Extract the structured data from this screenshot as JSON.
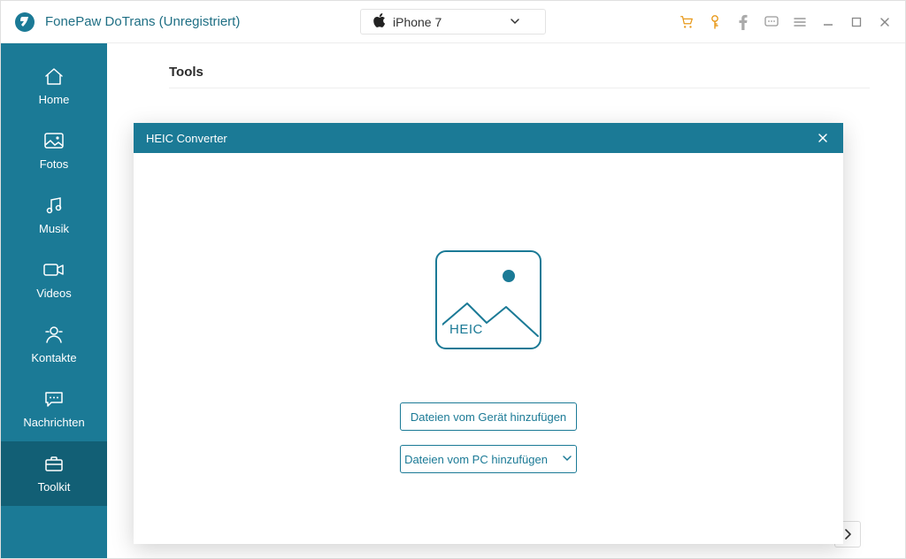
{
  "app": {
    "title": "FonePaw DoTrans (Unregistriert)"
  },
  "device": {
    "name": "iPhone 7"
  },
  "sidebar": {
    "items": [
      {
        "label": "Home"
      },
      {
        "label": "Fotos"
      },
      {
        "label": "Musik"
      },
      {
        "label": "Videos"
      },
      {
        "label": "Kontakte"
      },
      {
        "label": "Nachrichten"
      },
      {
        "label": "Toolkit"
      }
    ]
  },
  "main": {
    "section_title": "Tools"
  },
  "modal": {
    "title": "HEIC Converter",
    "tile_label": "HEIC",
    "btn_device": "Dateien vom Gerät hinzufügen",
    "btn_pc": "Dateien vom PC hinzufügen"
  }
}
